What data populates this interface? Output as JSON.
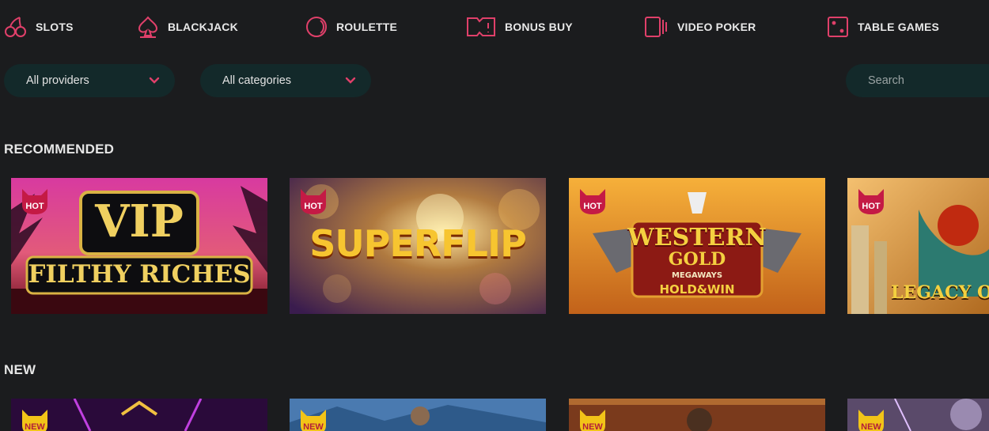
{
  "nav": [
    {
      "label": "SLOTS",
      "icon": "cherries-icon"
    },
    {
      "label": "BLACKJACK",
      "icon": "spade-icon"
    },
    {
      "label": "ROULETTE",
      "icon": "roulette-icon"
    },
    {
      "label": "BONUS BUY",
      "icon": "ticket-icon"
    },
    {
      "label": "VIDEO POKER",
      "icon": "video-poker-icon"
    },
    {
      "label": "TABLE GAMES",
      "icon": "dice-icon"
    }
  ],
  "filters": {
    "providers": "All providers",
    "categories": "All categories",
    "search_placeholder": "Search"
  },
  "sections": {
    "recommended": "RECOMMENDED",
    "new": "NEW"
  },
  "recommended_games": [
    {
      "badge": "HOT",
      "title_line1": "VIP",
      "title_line2": "FILTHY RICHES"
    },
    {
      "badge": "HOT",
      "title_line1": "SUPERFLIP",
      "title_line2": ""
    },
    {
      "badge": "HOT",
      "title_line1": "WESTERN",
      "title_line2": "GOLD",
      "title_line3": "MEGAWAYS",
      "title_line4": "HOLD&WIN"
    },
    {
      "badge": "HOT",
      "title_line1": "LEGACY OF",
      "title_line2": ""
    }
  ],
  "new_games": [
    {
      "badge": "NEW"
    },
    {
      "badge": "NEW"
    },
    {
      "badge": "NEW"
    },
    {
      "badge": "NEW"
    }
  ],
  "colors": {
    "accent": "#e0406a",
    "hot_badge": "#c41a45",
    "new_badge": "#f2c418",
    "field_bg": "#13292a",
    "page_bg": "#1b1c1e"
  }
}
